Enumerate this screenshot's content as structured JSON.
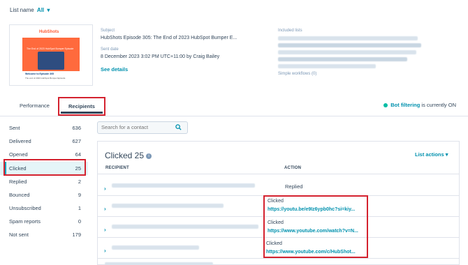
{
  "header": {
    "list_name_label": "List name",
    "list_name_value": "All",
    "list_name_caret": "▾"
  },
  "email": {
    "thumbnail": {
      "logo_text": "HubShots",
      "banner_text": "The End of 2023 HubSpot Bumper Episode",
      "welcome_text": "Welcome to Episode 305",
      "sub_text": "The end of 2023 HubSpot Bumper Episode"
    },
    "subject_label": "Subject",
    "subject_value": "HubShots Episode 305: The End of 2023 HubSpot Bumper E...",
    "sent_label": "Sent date",
    "sent_value": "8 December 2023 3:02 PM UTC+11:00 by Craig Bailey",
    "see_details": "See details",
    "included_lists_label": "Included lists",
    "simple_workflows": "Simple workflows (0)"
  },
  "tabs": {
    "performance": "Performance",
    "recipients": "Recipients"
  },
  "bot_filtering": {
    "link": "Bot filtering",
    "text": "is currently ON"
  },
  "sidebar": {
    "items": [
      {
        "label": "Sent",
        "count": "636"
      },
      {
        "label": "Delivered",
        "count": "627"
      },
      {
        "label": "Opened",
        "count": "64"
      },
      {
        "label": "Clicked",
        "count": "25"
      },
      {
        "label": "Replied",
        "count": "2"
      },
      {
        "label": "Bounced",
        "count": "9"
      },
      {
        "label": "Unsubscribed",
        "count": "1"
      },
      {
        "label": "Spam reports",
        "count": "0"
      },
      {
        "label": "Not sent",
        "count": "179"
      }
    ]
  },
  "search": {
    "placeholder": "Search for a contact",
    "icon": "search-icon"
  },
  "panel": {
    "title": "Clicked 25",
    "info_icon": "i",
    "list_actions": "List actions",
    "col_recipient": "RECIPIENT",
    "col_action": "ACTION",
    "rows": [
      {
        "action_label": "Replied",
        "action_link": ""
      },
      {
        "action_label": "Clicked",
        "action_link": "https://youtu.be/e9Iz6ypb0hc?si=kiy..."
      },
      {
        "action_label": "Clicked",
        "action_link": "https://www.youtube.com/watch?v=N..."
      },
      {
        "action_label": "Clicked",
        "action_link": "https://www.youtube.com/c/HubShot..."
      }
    ]
  },
  "colors": {
    "accent": "#0091ae",
    "highlight_box": "#d4222f",
    "active_bar": "#00a4bd",
    "status_dot": "#00bda5"
  }
}
